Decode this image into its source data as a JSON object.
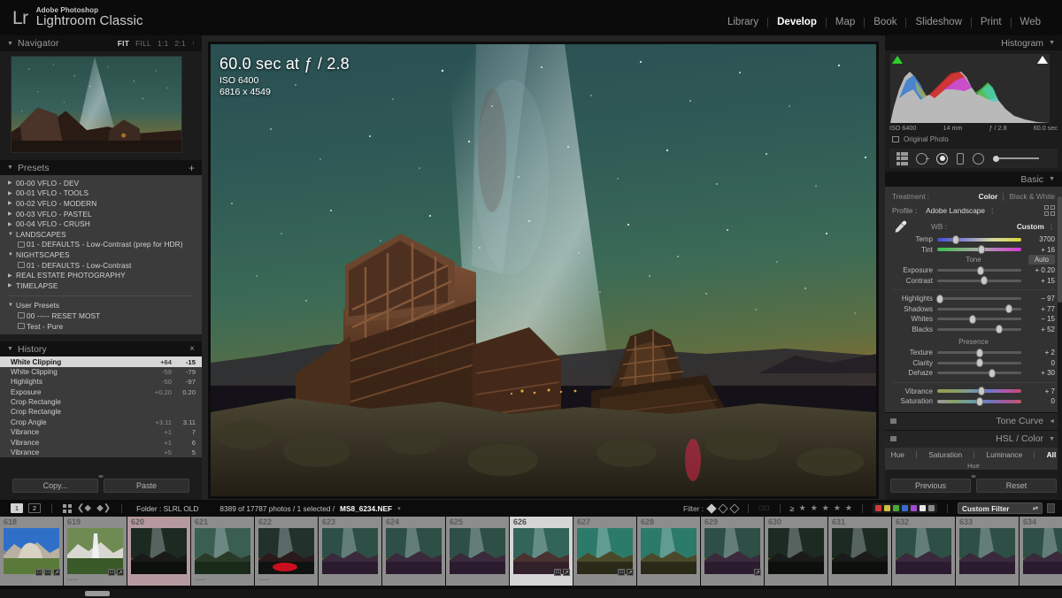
{
  "app": {
    "brand_lr": "Lr",
    "brand_adobe": "Adobe Photoshop",
    "brand_title": "Lightroom Classic"
  },
  "modules": [
    {
      "label": "Library",
      "active": false
    },
    {
      "label": "Develop",
      "active": true
    },
    {
      "label": "Map",
      "active": false
    },
    {
      "label": "Book",
      "active": false
    },
    {
      "label": "Slideshow",
      "active": false
    },
    {
      "label": "Print",
      "active": false
    },
    {
      "label": "Web",
      "active": false
    }
  ],
  "navigator": {
    "title": "Navigator",
    "zoom_modes": [
      "FIT",
      "FILL",
      "1:1",
      "2:1"
    ],
    "active_mode": "FIT"
  },
  "presets": {
    "title": "Presets",
    "add_label": "+",
    "items": [
      {
        "label": "00-00 VFLO - DEV",
        "type": "group",
        "expanded": false
      },
      {
        "label": "00-01 VFLO - TOOLS",
        "type": "group",
        "expanded": false
      },
      {
        "label": "00-02 VFLO - MODERN",
        "type": "group",
        "expanded": false
      },
      {
        "label": "00-03 VFLO - PASTEL",
        "type": "group",
        "expanded": false
      },
      {
        "label": "00-04 VFLO - CRUSH",
        "type": "group",
        "expanded": false
      },
      {
        "label": "LANDSCAPES",
        "type": "group",
        "expanded": true
      },
      {
        "label": "01 - DEFAULTS - Low-Contrast  (prep for HDR)",
        "type": "preset"
      },
      {
        "label": "NIGHTSCAPES",
        "type": "group",
        "expanded": true
      },
      {
        "label": "01 - DEFAULTS - Low-Contrast",
        "type": "preset"
      },
      {
        "label": "REAL ESTATE PHOTOGRAPHY",
        "type": "group",
        "expanded": false
      },
      {
        "label": "TIMELAPSE",
        "type": "group",
        "expanded": false
      }
    ],
    "user_group": {
      "label": "User Presets",
      "expanded": true
    },
    "user_items": [
      {
        "label": "00 ----- RESET MOST",
        "type": "preset"
      },
      {
        "label": "Test - Pure",
        "type": "preset"
      }
    ]
  },
  "history": {
    "title": "History",
    "close_label": "×",
    "rows": [
      {
        "name": "White Clipping",
        "delta": "+64",
        "value": "-15",
        "selected": true
      },
      {
        "name": "White Clipping",
        "delta": "-59",
        "value": "-79",
        "selected": false
      },
      {
        "name": "Highlights",
        "delta": "-50",
        "value": "-97",
        "selected": false
      },
      {
        "name": "Exposure",
        "delta": "+0.20",
        "value": "0.20",
        "selected": false
      },
      {
        "name": "Crop Rectangle",
        "delta": "",
        "value": "",
        "selected": false
      },
      {
        "name": "Crop Rectangle",
        "delta": "",
        "value": "",
        "selected": false
      },
      {
        "name": "Crop Angle",
        "delta": "+3.11",
        "value": "3.11",
        "selected": false
      },
      {
        "name": "Vibrance",
        "delta": "+1",
        "value": "7",
        "selected": false
      },
      {
        "name": "Vibrance",
        "delta": "+1",
        "value": "6",
        "selected": false
      },
      {
        "name": "Vibrance",
        "delta": "+5",
        "value": "5",
        "selected": false
      }
    ]
  },
  "left_buttons": {
    "copy": "Copy...",
    "paste": "Paste"
  },
  "photo": {
    "exposure_line": "60.0 sec at ƒ / 2.8",
    "iso_line": "ISO 6400",
    "dimensions_line": "6816 x 4549"
  },
  "histogram": {
    "title": "Histogram",
    "iso": "ISO 6400",
    "focal": "14 mm",
    "aperture": "ƒ / 2.8",
    "shutter": "60.0 sec",
    "original_photo": "Original Photo"
  },
  "basic": {
    "title": "Basic",
    "treatment_label": "Treatment :",
    "treatment_color": "Color",
    "treatment_bw": "Black & White",
    "profile_label": "Profile :",
    "profile_value": "Adobe Landscape",
    "wb_label": "WB :",
    "wb_value": "Custom",
    "wb_sliders": [
      {
        "name": "Temp",
        "value": "3700",
        "pos": 22
      },
      {
        "name": "Tint",
        "value": "+ 16",
        "pos": 53
      }
    ],
    "tone_label": "Tone",
    "auto_label": "Auto",
    "tone_sliders": [
      {
        "name": "Exposure",
        "value": "+ 0.20",
        "pos": 52
      },
      {
        "name": "Contrast",
        "value": "+ 15",
        "pos": 56
      }
    ],
    "tone_sliders2": [
      {
        "name": "Highlights",
        "value": "− 97",
        "pos": 3
      },
      {
        "name": "Shadows",
        "value": "+ 77",
        "pos": 85
      },
      {
        "name": "Whites",
        "value": "− 15",
        "pos": 42
      },
      {
        "name": "Blacks",
        "value": "+ 52",
        "pos": 74
      }
    ],
    "presence_label": "Presence",
    "presence_sliders": [
      {
        "name": "Texture",
        "value": "+ 2",
        "pos": 51
      },
      {
        "name": "Clarity",
        "value": "0",
        "pos": 50
      },
      {
        "name": "Dehaze",
        "value": "+ 30",
        "pos": 65
      }
    ],
    "color_sliders": [
      {
        "name": "Vibrance",
        "value": "+ 7",
        "pos": 53,
        "grad": "vib"
      },
      {
        "name": "Saturation",
        "value": "0",
        "pos": 50,
        "grad": "sat"
      }
    ]
  },
  "panels": {
    "tone_curve": "Tone Curve",
    "hsl_color": "HSL / Color",
    "hsl_tabs": [
      "Hue",
      "Saturation",
      "Luminance",
      "All"
    ],
    "hsl_active": "All"
  },
  "right_buttons": {
    "previous": "Previous",
    "reset": "Reset"
  },
  "toolbar": {
    "view1": "1",
    "view2": "2",
    "folder_label": "Folder : SLRL OLD",
    "count_text": "8389 of 17787 photos / 1 selected /",
    "filename": "MS8_6234.NEF",
    "filter_label": "Filter :",
    "rating_op": "≥",
    "custom_filter": "Custom Filter",
    "color_labels": [
      "#d03a3a",
      "#d0c23a",
      "#4aa83a",
      "#3a6ad0",
      "#a04ad0",
      "#e8e8e8",
      "#8a8a8a"
    ]
  },
  "filmstrip": {
    "cells": [
      {
        "num": "618",
        "badges": [
          "□",
          "□",
          "↗"
        ],
        "stars": "",
        "tint": false,
        "selected": false,
        "kind": "day-dome"
      },
      {
        "num": "619",
        "badges": [
          "□",
          "↗"
        ],
        "stars": "•••••",
        "tint": false,
        "selected": false,
        "kind": "day-fall"
      },
      {
        "num": "620",
        "badges": [],
        "stars": "",
        "tint": true,
        "selected": false,
        "kind": "night-dark"
      },
      {
        "num": "621",
        "badges": [],
        "stars": "•••••",
        "tint": false,
        "selected": false,
        "kind": "night-green"
      },
      {
        "num": "622",
        "badges": [],
        "stars": "•••••",
        "tint": false,
        "selected": false,
        "kind": "night-red"
      },
      {
        "num": "623",
        "badges": [],
        "stars": "",
        "tint": false,
        "selected": false,
        "kind": "night-purple"
      },
      {
        "num": "624",
        "badges": [],
        "stars": "",
        "tint": false,
        "selected": false,
        "kind": "night-purple"
      },
      {
        "num": "625",
        "badges": [],
        "stars": "",
        "tint": false,
        "selected": false,
        "kind": "night-purple"
      },
      {
        "num": "626",
        "badges": [
          "□",
          "↗"
        ],
        "stars": "",
        "tint": false,
        "selected": true,
        "kind": "night-main"
      },
      {
        "num": "627",
        "badges": [
          "□",
          "↗"
        ],
        "stars": "",
        "tint": false,
        "selected": false,
        "kind": "night-teal"
      },
      {
        "num": "628",
        "badges": [],
        "stars": "",
        "tint": false,
        "selected": false,
        "kind": "night-teal"
      },
      {
        "num": "629",
        "badges": [
          "↗"
        ],
        "stars": "",
        "tint": false,
        "selected": false,
        "kind": "night-purple"
      },
      {
        "num": "630",
        "badges": [],
        "stars": "",
        "tint": false,
        "selected": false,
        "kind": "night-dark"
      },
      {
        "num": "631",
        "badges": [],
        "stars": "",
        "tint": false,
        "selected": false,
        "kind": "night-dark"
      },
      {
        "num": "632",
        "badges": [],
        "stars": "",
        "tint": false,
        "selected": false,
        "kind": "night-purple"
      },
      {
        "num": "633",
        "badges": [],
        "stars": "",
        "tint": false,
        "selected": false,
        "kind": "night-purple"
      },
      {
        "num": "634",
        "badges": [],
        "stars": "",
        "tint": false,
        "selected": false,
        "kind": "night-purple"
      }
    ]
  }
}
